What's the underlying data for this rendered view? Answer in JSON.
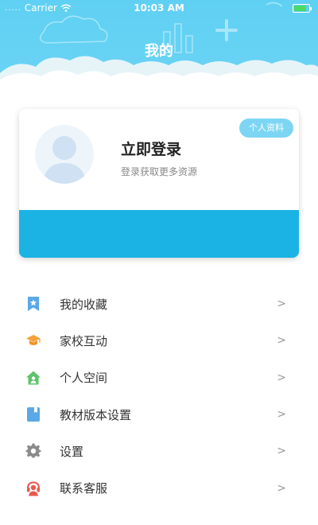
{
  "status_bar": {
    "signal": ".....",
    "carrier": "Carrier",
    "time": "10:03 AM"
  },
  "header": {
    "title": "我的",
    "background_color": "#5fd0f3"
  },
  "profile": {
    "title": "立即登录",
    "subtitle": "登录获取更多资源",
    "profile_button": "个人资料",
    "card_accent_color": "#1bb3e3"
  },
  "menu": {
    "items": [
      {
        "label": "我的收藏",
        "icon": "bookmark-star-icon",
        "color": "#5aa9e6"
      },
      {
        "label": "家校互动",
        "icon": "graduation-cap-icon",
        "color": "#f4a23b"
      },
      {
        "label": "个人空间",
        "icon": "home-icon",
        "color": "#5cc46a"
      },
      {
        "label": "教材版本设置",
        "icon": "book-icon",
        "color": "#5aa9e6"
      },
      {
        "label": "设置",
        "icon": "gear-icon",
        "color": "#888888"
      },
      {
        "label": "联系客服",
        "icon": "headset-icon",
        "color": "#e8584f"
      }
    ],
    "chevron": ">"
  }
}
